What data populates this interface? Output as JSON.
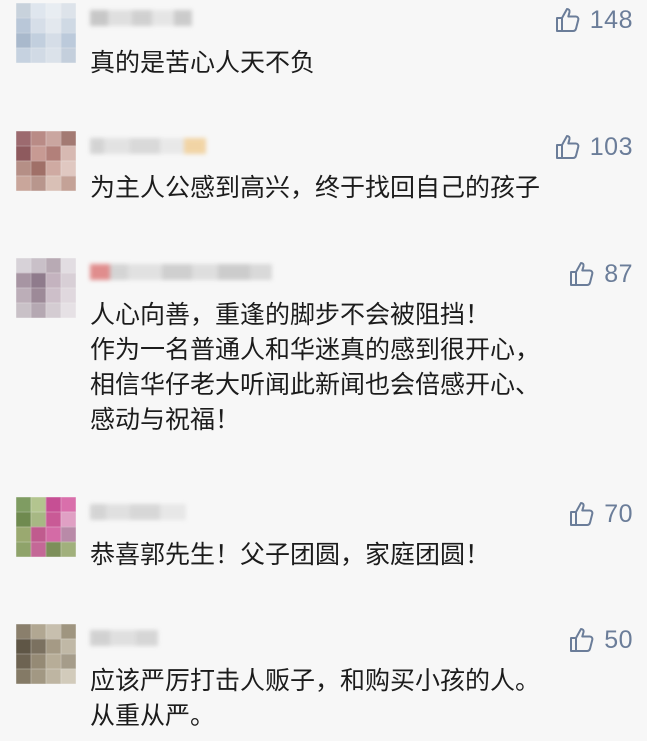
{
  "comments": [
    {
      "likes": "148",
      "text": "真的是苦心人天不负",
      "avatar_colors": [
        "#c8d2dc",
        "#dfe6ee",
        "#e8edf2",
        "#dde3ea",
        "#b9c7d8",
        "#d6dee8",
        "#e3e8ee",
        "#cfd9e4",
        "#a9b9cc",
        "#c2cfde",
        "#d5dde7",
        "#bccadb",
        "#c6d2e0",
        "#d1dae5",
        "#dbe2ea",
        "#c4cfdc"
      ],
      "name_colors": [
        "#b7b7b7",
        "#d8d8d8",
        "#c4c4c4",
        "#e0e0e0",
        "#bdbdbd"
      ]
    },
    {
      "likes": "103",
      "text": "为主人公感到高兴，终于找回自己的孩子",
      "avatar_colors": [
        "#9c6a6f",
        "#b98b86",
        "#caa6a0",
        "#a37a73",
        "#8e5a5e",
        "#c79a93",
        "#b2807a",
        "#d7b9b2",
        "#b58f86",
        "#a07068",
        "#cfaaa2",
        "#e0c8c1",
        "#c9a69b",
        "#b8968d",
        "#d9c0b6",
        "#c4a297"
      ],
      "name_colors": [
        "#c8c8c8",
        "#dcdcdc",
        "#cfcfcf",
        "#e4e4e4",
        "#f0c98a"
      ]
    },
    {
      "likes": "87",
      "text": "人心向善，重逢的脚步不会被阻挡！\n作为一名普通人和华迷真的感到很开心，\n相信华仔老大听闻此新闻也会倍感开心、\n感动与祝福！",
      "avatar_colors": [
        "#d7d2d8",
        "#c9c0c8",
        "#b8aab4",
        "#e2dde2",
        "#a795a3",
        "#8f7b8c",
        "#c4b3bf",
        "#d8cfd6",
        "#bcaeb8",
        "#9d8a98",
        "#cdbfc9",
        "#e0d8de",
        "#c9c1c7",
        "#b5a8b2",
        "#d4ccd2",
        "#e6e1e5"
      ],
      "name_colors": [
        "#d96a6a",
        "#c9c9c9",
        "#dadada",
        "#c2c2c2",
        "#d6d6d6",
        "#bebebe",
        "#cfcfcf"
      ]
    },
    {
      "likes": "70",
      "text": "恭喜郭先生！父子团圆，家庭团圆！",
      "avatar_colors": [
        "#7f9c62",
        "#b3c58f",
        "#c64f94",
        "#d96fab",
        "#6f8a4f",
        "#a7b884",
        "#c95a96",
        "#e0a0c4",
        "#9aa970",
        "#c05b8e",
        "#d46ba6",
        "#b98aa8",
        "#8fa36a",
        "#c46897",
        "#7d8f5a",
        "#a1b07c"
      ],
      "name_colors": [
        "#c9c9c9",
        "#d9d9d9",
        "#cdcdcd",
        "#e2e2e2"
      ]
    },
    {
      "likes": "50",
      "text": "应该严厉打击人贩子，和购买小孩的人。\n从重从严。",
      "avatar_colors": [
        "#8a7f6c",
        "#b1a792",
        "#c7bfae",
        "#9f9580",
        "#5f5646",
        "#7b7160",
        "#a59a85",
        "#c0b8a6",
        "#6d6352",
        "#958a75",
        "#b7ad98",
        "#a59c8a",
        "#847a66",
        "#a29883",
        "#beb5a2",
        "#d2cbbb"
      ],
      "name_colors": [
        "#c5c5c5",
        "#d8d8d8",
        "#cbcbcb"
      ]
    }
  ]
}
